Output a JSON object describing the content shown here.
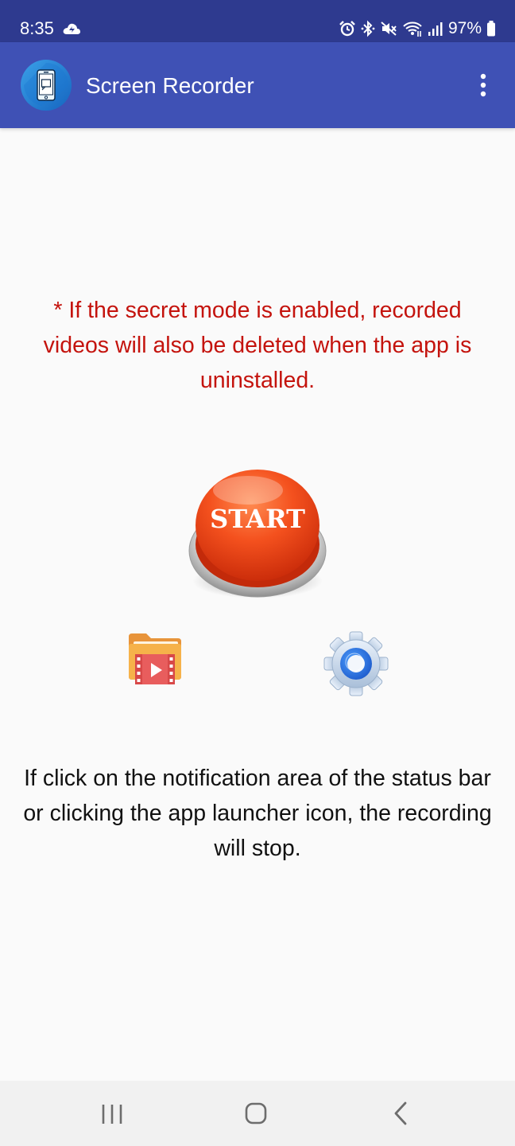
{
  "status_bar": {
    "time": "8:35",
    "battery_text": "97%",
    "icons": [
      "cloud-icon",
      "alarm-icon",
      "bluetooth-icon",
      "mute-icon",
      "wifi-icon",
      "signal-icon",
      "battery-icon"
    ]
  },
  "app_bar": {
    "title": "Screen Recorder",
    "logo_icon": "screen-cast-phone-icon",
    "menu_icon": "more-vert-icon",
    "color": "#3f51b5"
  },
  "main": {
    "warning_text": "* If the secret mode is enabled, recorded videos will also be deleted when the app is uninstalled.",
    "start_label": "START",
    "videos_icon": "video-folder-icon",
    "settings_icon": "gear-icon",
    "info_text": "If click on the notification area of the status bar or clicking the app launcher icon, the recording will stop.",
    "warning_color": "#c4130d"
  },
  "nav_bar": {
    "icons": [
      "recents-icon",
      "home-icon",
      "back-icon"
    ]
  }
}
